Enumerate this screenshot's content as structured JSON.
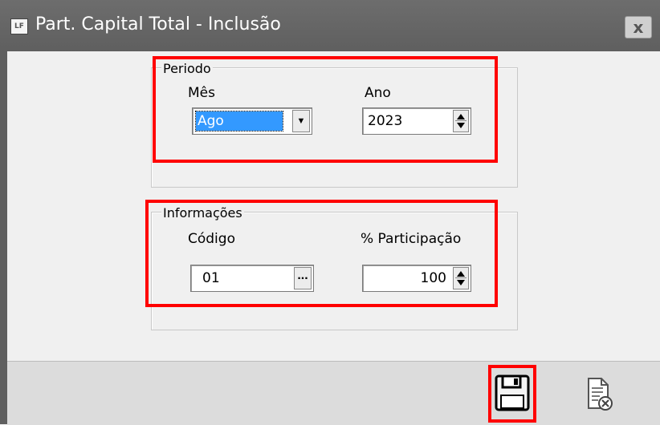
{
  "window": {
    "title": "Part. Capital Total - Inclusão",
    "app_icon_text": "LF",
    "close_symbol": "x"
  },
  "periodo": {
    "legend": "Periodo",
    "mes_label": "Mês",
    "mes_value": "Ago",
    "ano_label": "Ano",
    "ano_value": "2023"
  },
  "informacoes": {
    "legend": "Informações",
    "codigo_label": "Código",
    "codigo_value": "01",
    "codigo_lookup_symbol": "...",
    "participacao_label": "% Participação",
    "participacao_value": "100"
  },
  "toolbar": {
    "save_icon": "save-icon",
    "cancel_icon": "cancel-document-icon"
  },
  "colors": {
    "highlight_red": "#ff0000",
    "selection_blue": "#3399ff",
    "titlebar": "#636363"
  }
}
